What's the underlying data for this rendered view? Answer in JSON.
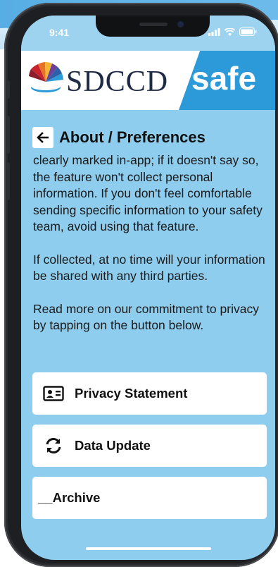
{
  "status": {
    "time": "9:41"
  },
  "header": {
    "logo_text": "SDCCD",
    "brand_text": "safe"
  },
  "page": {
    "title": "About / Preferences"
  },
  "content": {
    "partial_top": "clearly marked in-app; if it doesn't say so, the feature won't collect personal information. If you don't feel comfortable sending specific information to your safety team, avoid using that feature.",
    "paragraph2": "If collected, at no time will your information be shared with any third parties.",
    "paragraph3": "Read more on our commitment to privacy by tapping on the button below."
  },
  "buttons": [
    {
      "label": "Privacy Statement",
      "icon": "id-card-icon"
    },
    {
      "label": "Data Update",
      "icon": "refresh-icon"
    },
    {
      "label": "__Archive"
    }
  ],
  "colors": {
    "screen_bg": "#8fcdee",
    "brand_blue": "#2c9ad8",
    "status_bar": "#9ed3ef"
  }
}
